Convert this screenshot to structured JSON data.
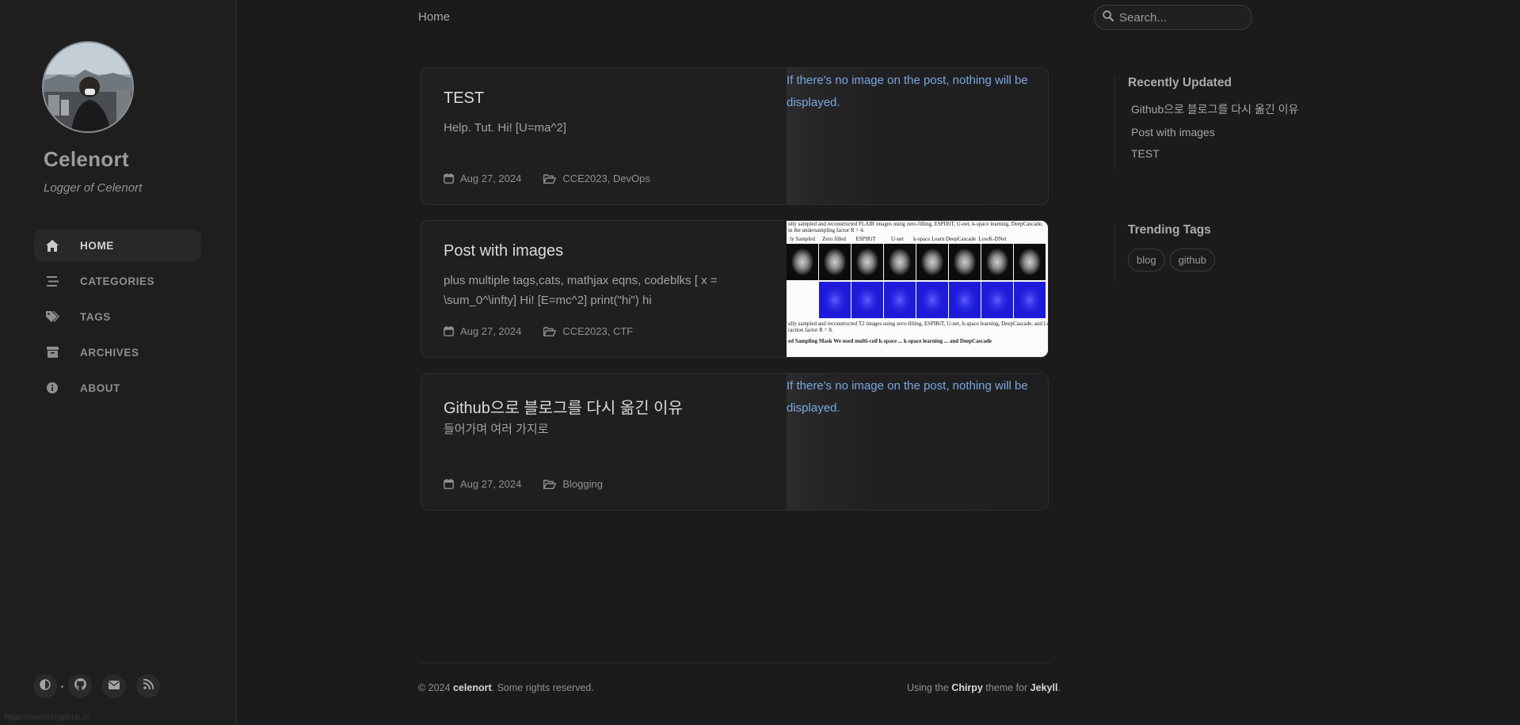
{
  "site": {
    "title": "Celenort",
    "subtitle": "Logger of Celenort"
  },
  "nav": [
    {
      "label": "HOME",
      "icon": "home-icon",
      "active": true
    },
    {
      "label": "CATEGORIES",
      "icon": "stream-icon",
      "active": false
    },
    {
      "label": "TAGS",
      "icon": "tags-icon",
      "active": false
    },
    {
      "label": "ARCHIVES",
      "icon": "archive-icon",
      "active": false
    },
    {
      "label": "ABOUT",
      "icon": "info-circle-icon",
      "active": false
    }
  ],
  "sidebar_bottom": [
    "theme-toggle-icon",
    "github-icon",
    "email-icon",
    "rss-icon"
  ],
  "breadcrumb": "Home",
  "search": {
    "placeholder": "Search..."
  },
  "posts": [
    {
      "title": "TEST",
      "excerpt": "Help. Tut. Hi! [U=ma^2]",
      "date": "Aug 27, 2024",
      "categories": "CCE2023, DevOps",
      "image_alt": "If there's no image on the post, nothing will be displayed."
    },
    {
      "title": "Post with images",
      "excerpt": "plus multiple tags,cats, mathjax eqns, codeblks [ x = \\sum_0^\\infty] Hi! [E=mc^2] print(\"hi\") hi",
      "date": "Aug 27, 2024",
      "categories": "CCE2023, CTF",
      "figure": {
        "caption_top": "ully sampled and reconstructed FLAIR images using zero-filling, ESPIRiT, U-net, k-space learning, DeepCascade,",
        "caption_top2": "in the undersampling factor R = 4.",
        "headers": [
          "ly Sampled",
          "Zero filled",
          "ESPIRiT",
          "U-net",
          "k-space Learning",
          "DeepCascade",
          "LowK-DNet"
        ],
        "caption_bottom": "ully sampled and reconstructed T2 images using zero-filling, ESPIRiT, U-net, k-space learning, DeepCascade, and Lo",
        "caption_bottom2": "raction factor R = 8.",
        "caption_bottom3": "ed Sampling Mask   We used multi-coil k-space ...  k-space learning ... and DeepCascade"
      }
    },
    {
      "title": "Github으로 블로그를 다시 옮긴 이유",
      "excerpt": "들어가며 여러 가지로",
      "date": "Aug 27, 2024",
      "categories": "Blogging",
      "image_alt": "If there's no image on the post, nothing will be displayed."
    }
  ],
  "recently_updated": {
    "heading": "Recently Updated",
    "items": [
      "Github으로 블로그를 다시 옮긴 이유",
      "Post with images",
      "TEST"
    ]
  },
  "trending_tags": {
    "heading": "Trending Tags",
    "items": [
      "blog",
      "github"
    ]
  },
  "footer": {
    "copyright": "© 2024",
    "owner": "celenort",
    "rights": ". Some rights reserved.",
    "using": "Using the",
    "theme": "Chirpy",
    "theme_for": "theme for",
    "engine": "Jekyll",
    "period": "."
  },
  "status_url": "https://celenort.github.io"
}
